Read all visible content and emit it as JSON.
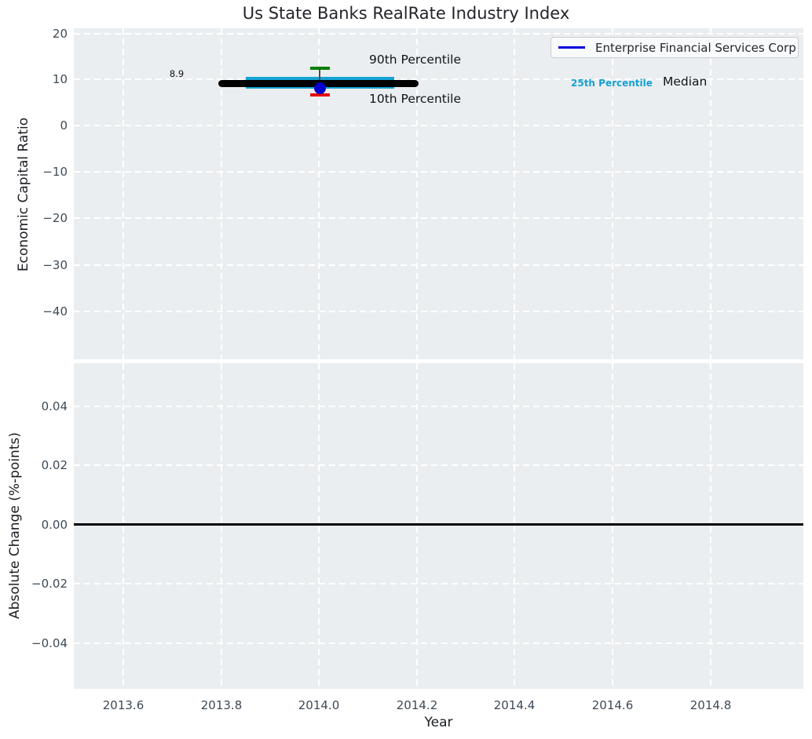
{
  "text": {
    "title": "Us State Banks RealRate Industry Index",
    "legend_label": "Enterprise Financial Services Corp",
    "label_median_value": "8.9",
    "p90": "90th Percentile",
    "p10": "10th Percentile",
    "p25": "25th Percentile",
    "median": "Median",
    "ylabel_top": "Economic Capital Ratio",
    "ylabel_bottom": "Absolute Change (%-points)",
    "xlabel": "Year",
    "yticks_top": [
      "20",
      "10",
      "0",
      "−10",
      "−20",
      "−30",
      "−40"
    ],
    "yticks_bottom": [
      "0.04",
      "0.02",
      "0.00",
      "−0.02",
      "−0.04"
    ],
    "xticks": [
      "2013.6",
      "2013.8",
      "2014.0",
      "2014.2",
      "2014.4",
      "2014.6",
      "2014.8"
    ]
  },
  "colors": {
    "axes_background": "#eaeef0",
    "grid": "#ffffff",
    "median_line": "#000000",
    "iqr_band": "#14a3d4",
    "p90_cap": "#008000",
    "p10_cap": "#e50000",
    "company_point": "#0000cd",
    "legend_line": "#0000dd",
    "zero_line": "#000000",
    "tick_labels": "#3d4a57"
  },
  "chart_data": [
    {
      "type": "scatter",
      "title": "Us State Banks RealRate Industry Index",
      "ylabel": "Economic Capital Ratio",
      "xlim": [
        2013.5,
        2015.0
      ],
      "ylim": [
        -50,
        21
      ],
      "yticks": [
        20,
        10,
        0,
        -10,
        -20,
        -30,
        -40
      ],
      "grid": true,
      "legend": {
        "position": "upper right",
        "entries": [
          "Enterprise Financial Services Corp"
        ]
      },
      "series": [
        {
          "name": "Enterprise Financial Services Corp",
          "type": "point",
          "x": 2014.0,
          "y": 8.2,
          "color": "#0000cd"
        },
        {
          "name": "Median",
          "type": "horizontal-segment",
          "y": 8.9,
          "x_from": 2013.8,
          "x_to": 2014.2,
          "color": "#000000",
          "data_label": "8.9"
        },
        {
          "name": "25th-75th Percentile band",
          "type": "band",
          "y_from": 7.8,
          "y_to": 10.6,
          "x_from": 2013.85,
          "x_to": 2014.15,
          "color": "#14a3d4"
        },
        {
          "name": "90th Percentile",
          "type": "errorbar-cap",
          "x": 2014.0,
          "y": 12.6,
          "color": "#008000"
        },
        {
          "name": "10th Percentile",
          "type": "errorbar-cap",
          "x": 2014.0,
          "y": 6.7,
          "color": "#e50000"
        }
      ],
      "annotations": [
        {
          "text": "8.9",
          "x": 2013.71,
          "y": 10.3
        },
        {
          "text": "90th Percentile",
          "x": 2014.11,
          "y": 14.8
        },
        {
          "text": "10th Percentile",
          "x": 2014.11,
          "y": 4.3
        },
        {
          "text": "25th Percentile",
          "x": 2014.52,
          "y": 8.9,
          "color": "#16a0d2"
        },
        {
          "text": "Median",
          "x": 2014.71,
          "y": 8.9
        }
      ]
    },
    {
      "type": "line",
      "ylabel": "Absolute Change (%-points)",
      "xlabel": "Year",
      "xlim": [
        2013.5,
        2015.0
      ],
      "ylim": [
        -0.055,
        0.055
      ],
      "yticks": [
        0.04,
        0.02,
        0.0,
        -0.02,
        -0.04
      ],
      "xticks": [
        2013.6,
        2013.8,
        2014.0,
        2014.2,
        2014.4,
        2014.6,
        2014.8
      ],
      "grid": true,
      "series": [
        {
          "name": "zero-line",
          "type": "hline",
          "y": 0.0,
          "color": "#000000"
        }
      ]
    }
  ]
}
